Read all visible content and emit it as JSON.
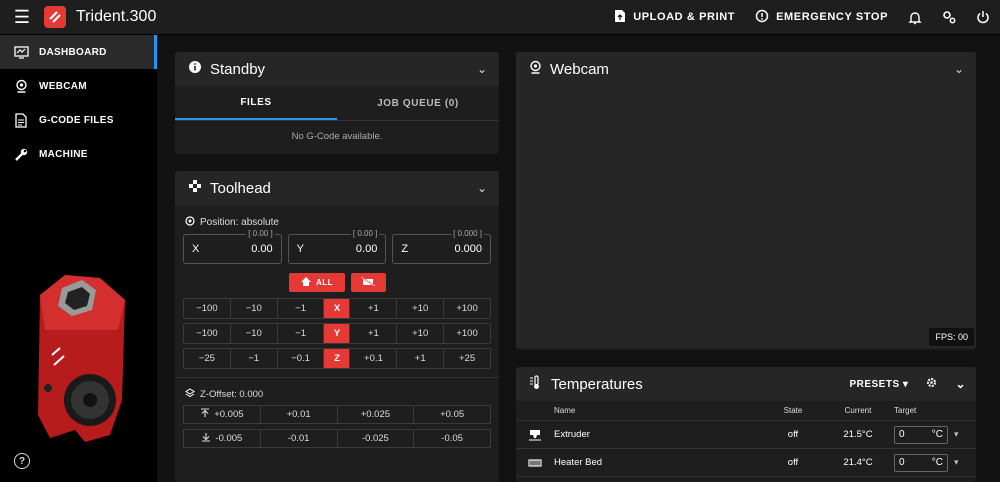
{
  "app": {
    "title": "Trident.300"
  },
  "topbar": {
    "upload_label": "UPLOAD & PRINT",
    "estop_label": "EMERGENCY STOP"
  },
  "sidebar": {
    "items": [
      {
        "label": "DASHBOARD",
        "icon": "monitor-dashboard-icon",
        "active": true
      },
      {
        "label": "WEBCAM",
        "icon": "webcam-icon",
        "active": false
      },
      {
        "label": "G-CODE FILES",
        "icon": "file-document-icon",
        "active": false
      },
      {
        "label": "MACHINE",
        "icon": "wrench-icon",
        "active": false
      }
    ]
  },
  "standby": {
    "title": "Standby",
    "tabs": [
      "FILES",
      "JOB QUEUE (0)"
    ],
    "empty_message": "No G-Code available."
  },
  "toolhead": {
    "title": "Toolhead",
    "position_label": "Position: absolute",
    "coords": [
      {
        "axis": "X",
        "value": "0.00",
        "small": "[ 0.00 ]"
      },
      {
        "axis": "Y",
        "value": "0.00",
        "small": "[ 0.00 ]"
      },
      {
        "axis": "Z",
        "value": "0.000",
        "small": "[ 0.000 ]"
      }
    ],
    "home_all_label": "ALL",
    "jog": {
      "x": {
        "axis": "X",
        "neg": [
          "−100",
          "−10",
          "−1"
        ],
        "pos": [
          "+1",
          "+10",
          "+100"
        ]
      },
      "y": {
        "axis": "Y",
        "neg": [
          "−100",
          "−10",
          "−1"
        ],
        "pos": [
          "+1",
          "+10",
          "+100"
        ]
      },
      "z": {
        "axis": "Z",
        "neg": [
          "−25",
          "−1",
          "−0.1"
        ],
        "pos": [
          "+0.1",
          "+1",
          "+25"
        ]
      }
    },
    "zoffset_label": "Z-Offset: 0.000",
    "zoffset_up": [
      "+0.005",
      "+0.01",
      "+0.025",
      "+0.05"
    ],
    "zoffset_down": [
      "-0.005",
      "-0.01",
      "-0.025",
      "-0.05"
    ]
  },
  "webcam": {
    "title": "Webcam",
    "fps": "FPS: 00"
  },
  "temperatures": {
    "title": "Temperatures",
    "presets_label": "PRESETS",
    "headers": {
      "name": "Name",
      "state": "State",
      "current": "Current",
      "target": "Target"
    },
    "rows": [
      {
        "name": "Extruder",
        "state": "off",
        "current": "21.5°C",
        "target": "0",
        "unit": "°C"
      },
      {
        "name": "Heater Bed",
        "state": "off",
        "current": "21.4°C",
        "target": "0",
        "unit": "°C"
      }
    ]
  },
  "colors": {
    "accent_red": "#e53935",
    "accent_blue": "#2196f3",
    "background": "#121212",
    "card": "#1e1e1e"
  }
}
